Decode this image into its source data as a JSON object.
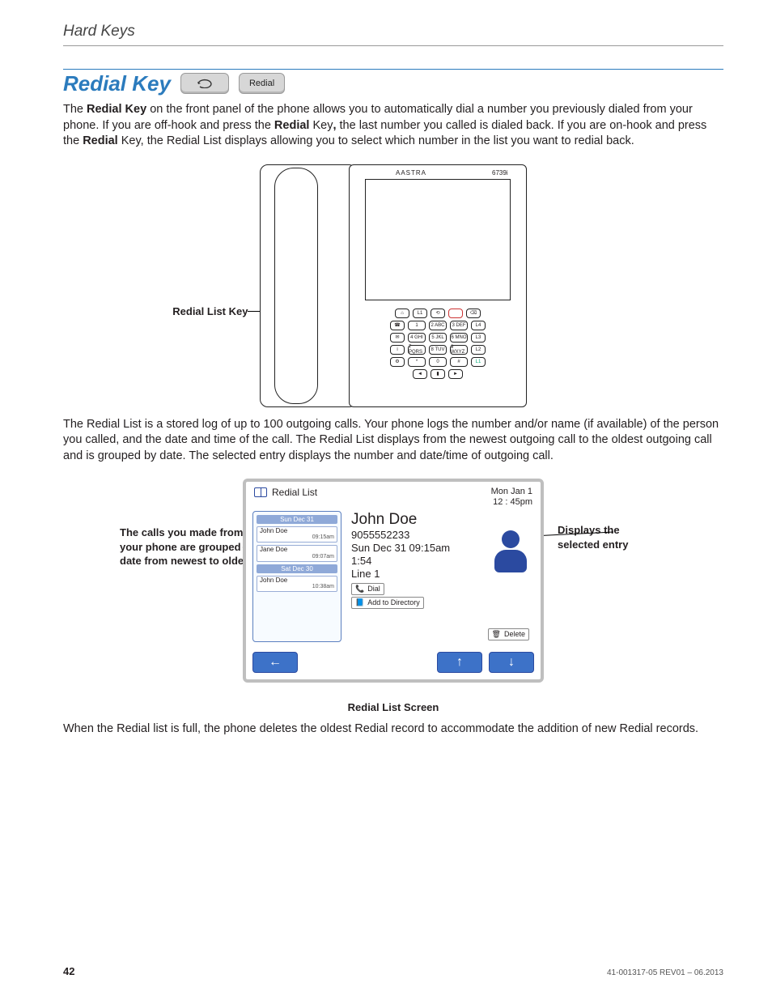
{
  "header": {
    "running": "Hard Keys"
  },
  "section": {
    "title": "Redial Key",
    "key_label": "Redial"
  },
  "para1": {
    "a": "The ",
    "b1": "Redial Key",
    "c": " on the front panel of the phone allows you to automatically dial a number you previously dialed from your phone. If you are off-hook and press the ",
    "b2": "Redial",
    "d": " Key",
    "comma": ",",
    "e": " the last number you called is dialed back. If you are on-hook and press the ",
    "b3": "Redial",
    "f": " Key, the Redial List displays allowing you to select which number in the list you want to redial back."
  },
  "phone": {
    "brand": "AASTRA",
    "model": "6739i",
    "redial_label": "Redial List Key",
    "keypad": {
      "r1": [
        "⌂",
        "L1",
        "⟲",
        "",
        "⌫"
      ],
      "r2": [
        "☎",
        "1",
        "2 ABC",
        "3 DEF",
        "L4"
      ],
      "r3": [
        "✉",
        "4 GHI",
        "5 JKL",
        "6 MNO",
        "L3"
      ],
      "r4": [
        "i",
        "7 PQRS",
        "8 TUV",
        "9 WXYZ",
        "L2"
      ],
      "r5": [
        "⚙",
        "*",
        "0",
        "#",
        "L1"
      ],
      "r6": [
        "◄",
        "▮",
        "►"
      ]
    }
  },
  "para2": "The Redial List is a stored log of up to 100 outgoing calls. Your phone logs the number and/or name (if available) of the person you called, and the date and time of the call. The Redial List displays from the newest outgoing call to the oldest outgoing call and is grouped by date. The selected entry displays the number and date/time of outgoing call.",
  "callouts": {
    "left": "The calls you made from your phone are grouped by date from newest to oldest",
    "right": "Displays the selected entry"
  },
  "redial_screen": {
    "title": "Redial List",
    "clock_date": "Mon Jan 1",
    "clock_time": "12 : 45pm",
    "groups": [
      {
        "date": "Sun Dec 31",
        "items": [
          {
            "name": "John Doe",
            "time": "09:15am"
          },
          {
            "name": "Jane Doe",
            "time": "09:07am"
          }
        ]
      },
      {
        "date": "Sat Dec 30",
        "items": [
          {
            "name": "John Doe",
            "time": "10:38am"
          }
        ]
      }
    ],
    "selected": {
      "name": "John Doe",
      "number": "9055552233",
      "when": "Sun Dec 31 09:15am",
      "duration": "1:54",
      "line": "Line 1"
    },
    "buttons": {
      "dial": "Dial",
      "add": "Add to Directory",
      "delete": "Delete"
    },
    "caption": "Redial List Screen"
  },
  "para3": "When the Redial list is full, the phone deletes the oldest Redial record to accommodate the addition of new Redial records.",
  "footer": {
    "page": "42",
    "doc": "41-001317-05  REV01 – 06.2013"
  }
}
